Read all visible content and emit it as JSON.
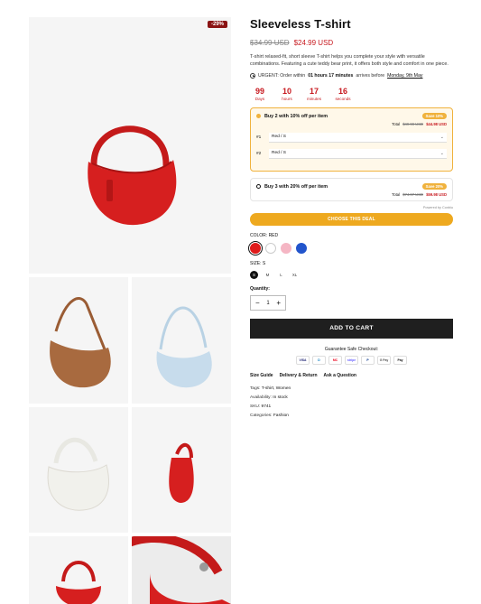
{
  "product": {
    "title": "Sleeveless T-shirt",
    "old_price": "$34.99 USD",
    "new_price": "$24.99 USD",
    "discount_badge": "-29%",
    "description": "T-shirt relaxed-fit, short sleeve T-shirt helps you complete your style with versatile combinations. Featuring a cute teddy bear print, it offers both style and comfort in one piece."
  },
  "urgent": {
    "prefix": "URGENT: Order within",
    "time": "01 hours 17 minutes",
    "middle": "arrives before",
    "date": "Monday, 9th May"
  },
  "countdown": [
    {
      "value": "99",
      "label": "Days"
    },
    {
      "value": "10",
      "label": "hours"
    },
    {
      "value": "17",
      "label": "minutes"
    },
    {
      "value": "16",
      "label": "seconds"
    }
  ],
  "deal1": {
    "title": "Buy 2 with 10% off per item",
    "save": "Save 10%",
    "total_label": "Total",
    "total_old": "$49.98 USD",
    "total_new": "$44.98 USD",
    "rows": [
      {
        "idx": "#1",
        "value": "Red / S"
      },
      {
        "idx": "#2",
        "value": "Red / S"
      }
    ]
  },
  "deal2": {
    "title": "Buy 3 with 20% off per item",
    "save": "Save 20%",
    "total_label": "Total",
    "total_old": "$74.97 USD",
    "total_new": "$59.98 USD"
  },
  "powered": "Powered by Conbiu",
  "choose_label": "CHOOSE THIS DEAL",
  "color": {
    "label": "COLOR:",
    "value": "RED",
    "swatches": [
      "#e01b1b",
      "#ffffff",
      "#f5b6c4",
      "#2255cc"
    ]
  },
  "size": {
    "label": "SIZE:",
    "value": "S",
    "options": [
      "S",
      "M",
      "L",
      "XL"
    ]
  },
  "quantity": {
    "label": "Quantity:",
    "value": "1",
    "minus": "−",
    "plus": "+"
  },
  "add_to_cart": "ADD TO CART",
  "guarantee": "Guarantee Safe Checkout:",
  "payments": [
    "VISA",
    "D",
    "MC",
    "stripe",
    "P",
    "G Pay",
    "Pay"
  ],
  "links": [
    "Size Guide",
    "Delivery & Return",
    "Ask a Question"
  ],
  "meta": {
    "tags_label": "Tags:",
    "tags": "T-shirt, Women",
    "availability_label": "Availability:",
    "availability": "In stock",
    "sku_label": "SKU:",
    "sku": "9741",
    "categories_label": "Categories:",
    "categories": "Fashion"
  }
}
